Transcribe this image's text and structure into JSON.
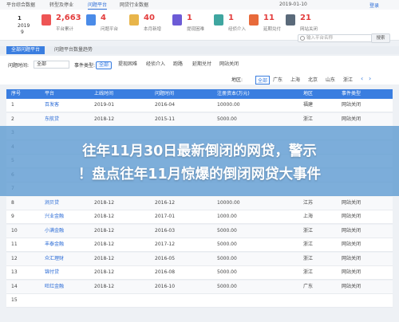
{
  "topnav": {
    "tabs": [
      "平台综合数据",
      "转型及停业",
      "问题平台",
      "网贷行业数据"
    ],
    "active_tab": 2,
    "date": "2019-01-10",
    "login": "登录"
  },
  "stats": [
    {
      "num": "1",
      "label": "2019",
      "label2": "9",
      "first": true
    },
    {
      "num": "2,663",
      "label": "平台累计",
      "color": "#ee5555"
    },
    {
      "num": "4",
      "label": "问题平台",
      "color": "#4a8be8"
    },
    {
      "num": "40",
      "label": "本月新增",
      "color": "#e8b54a"
    },
    {
      "num": "1",
      "label": "提现困难",
      "color": "#6c5bd6"
    },
    {
      "num": "1",
      "label": "经侦介入",
      "color": "#3fa6a0"
    },
    {
      "num": "11",
      "label": "延期兑付",
      "color": "#e86a3a"
    },
    {
      "num": "21",
      "label": "网站关闭",
      "color": "#5a6a7a"
    }
  ],
  "search": {
    "placeholder": "输入平台名称",
    "button": "搜索"
  },
  "subtabs": [
    "全部问题平台",
    "问题平台数量趋势"
  ],
  "filters": {
    "time_label": "问题时间:",
    "time_value": "全部",
    "type_label": "事件类型:",
    "types": [
      "全部",
      "提现困难",
      "经侦介入",
      "跑路",
      "延期兑付",
      "网站关闭"
    ],
    "region_label": "地区:",
    "regions": [
      "全部",
      "广东",
      "上海",
      "北京",
      "山东",
      "浙江"
    ]
  },
  "table": {
    "headers": [
      "序号",
      "平台",
      "上线时间",
      "问题时间",
      "注册资本(万元)",
      "地区",
      "事件类型"
    ],
    "rows": [
      [
        "1",
        "百发客",
        "2019-01",
        "2016-04",
        "10000.00",
        "福建",
        "网站关闭"
      ],
      [
        "2",
        "东航贷",
        "2018-12",
        "2015-11",
        "5000.00",
        "浙江",
        "网站关闭"
      ],
      [
        "3",
        "",
        "",
        "",
        "",
        "",
        ""
      ],
      [
        "4",
        "",
        "",
        "",
        "",
        "",
        ""
      ],
      [
        "5",
        "",
        "",
        "",
        "",
        "",
        ""
      ],
      [
        "6",
        "",
        "",
        "",
        "",
        "",
        ""
      ],
      [
        "7",
        "",
        "",
        "",
        "",
        "",
        ""
      ],
      [
        "8",
        "涧贝贷",
        "2018-12",
        "2016-12",
        "10000.00",
        "江苏",
        "网站关闭"
      ],
      [
        "9",
        "兴业金融",
        "2018-12",
        "2017-01",
        "1000.00",
        "上海",
        "网站关闭"
      ],
      [
        "10",
        "小满金融",
        "2018-12",
        "2016-03",
        "5000.00",
        "浙江",
        "网站关闭"
      ],
      [
        "11",
        "丰泰金融",
        "2018-12",
        "2017-12",
        "5000.00",
        "浙江",
        "网站关闭"
      ],
      [
        "12",
        "众汇理财",
        "2018-12",
        "2016-05",
        "5000.00",
        "浙江",
        "网站关闭"
      ],
      [
        "13",
        "锦付贷",
        "2018-12",
        "2016-08",
        "5000.00",
        "浙江",
        "网站关闭"
      ],
      [
        "14",
        "旺红金融",
        "2018-12",
        "2016-10",
        "5000.00",
        "广东",
        "网站关闭"
      ],
      [
        "15",
        "",
        "",
        "",
        "",
        "",
        ""
      ]
    ]
  },
  "banner": {
    "line1": "往年11月30日最新倒闭的网贷，警示",
    "line2": "！盘点往年11月惊爆的倒闭网贷大事件"
  }
}
